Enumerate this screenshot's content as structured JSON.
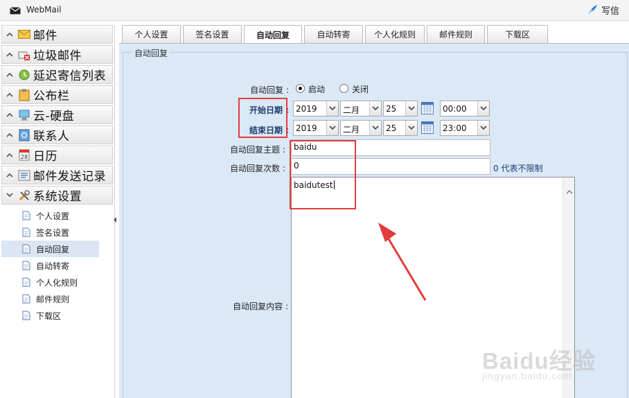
{
  "app": {
    "title": "WebMail",
    "compose_label": "写信"
  },
  "sidebar": {
    "items": [
      {
        "label": "邮件",
        "icon": "envelope-icon"
      },
      {
        "label": "垃圾邮件",
        "icon": "trash-mail-icon"
      },
      {
        "label": "延迟寄信列表",
        "icon": "clock-icon"
      },
      {
        "label": "公布栏",
        "icon": "clipboard-icon"
      },
      {
        "label": "云-硬盘",
        "icon": "computer-icon"
      },
      {
        "label": "联系人",
        "icon": "contacts-icon"
      },
      {
        "label": "日历",
        "icon": "calendar-icon"
      },
      {
        "label": "邮件发送记录",
        "icon": "log-icon"
      },
      {
        "label": "系统设置",
        "icon": "tools-icon"
      }
    ],
    "sub_items": [
      {
        "label": "个人设置"
      },
      {
        "label": "签名设置"
      },
      {
        "label": "自动回复",
        "active": true
      },
      {
        "label": "自动转寄"
      },
      {
        "label": "个人化规则"
      },
      {
        "label": "邮件规则"
      },
      {
        "label": "下载区"
      }
    ]
  },
  "tabs": [
    {
      "label": "个人设置"
    },
    {
      "label": "签名设置"
    },
    {
      "label": "自动回复",
      "active": true
    },
    {
      "label": "自动转寄"
    },
    {
      "label": "个人化规则"
    },
    {
      "label": "邮件规则"
    },
    {
      "label": "下载区"
    }
  ],
  "form": {
    "legend": "自动回复",
    "auto_reply_label": "自动回复 :",
    "enable_label": "启动",
    "disable_label": "关闭",
    "enabled": true,
    "start_label": "开始日期 :",
    "end_label": "结束日期 :",
    "start": {
      "year": "2019",
      "month": "二月",
      "day": "25",
      "time": "00:00"
    },
    "end": {
      "year": "2019",
      "month": "二月",
      "day": "25",
      "time": "23:00"
    },
    "subject_label": "自动回复主题 :",
    "subject_value": "baidu",
    "count_label": "自动回复次数 :",
    "count_value": "0",
    "count_hint": "0 代表不限制",
    "content_label": "自动回复内容 :",
    "content_value": "baidutest"
  },
  "watermark": {
    "main": "Baidu经验",
    "sub": "jingyan.baidu.com"
  },
  "colors": {
    "accent": "#dbe8f6",
    "annotation": "#e23b3b",
    "label_blue": "#1c3b6e"
  }
}
